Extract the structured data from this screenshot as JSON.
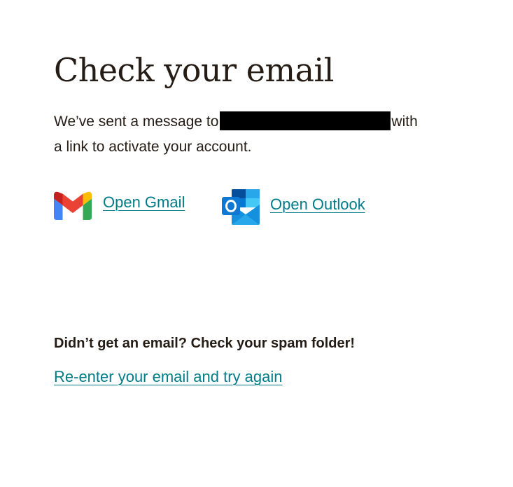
{
  "heading": "Check your email",
  "message": {
    "before_email": "We’ve sent a message to",
    "email_redacted": true,
    "after_email": "with",
    "line2": "a link to activate your account."
  },
  "providers": [
    {
      "label": "Open Gmail",
      "icon": "gmail-icon"
    },
    {
      "label": "Open Outlook",
      "icon": "outlook-icon"
    }
  ],
  "footer": {
    "note": "Didn’t get an email? Check your spam folder!",
    "retry_link": "Re-enter your email and try again"
  },
  "colors": {
    "text": "#241c15",
    "link": "#007c89",
    "background": "#ffffff",
    "redaction": "#000000"
  }
}
